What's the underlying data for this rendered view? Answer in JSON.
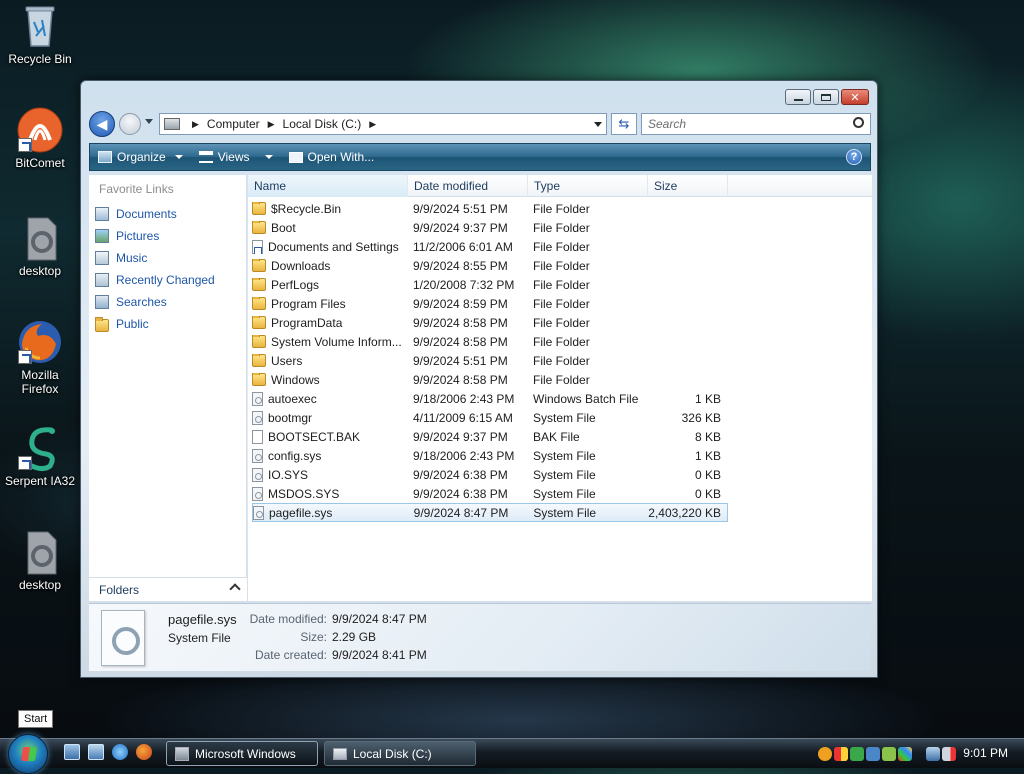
{
  "desktop": {
    "icons": [
      {
        "label": "Recycle Bin"
      },
      {
        "label": "BitComet"
      },
      {
        "label": "desktop"
      },
      {
        "label": "Mozilla Firefox"
      },
      {
        "label": "Serpent IA32"
      },
      {
        "label": "desktop"
      }
    ]
  },
  "window": {
    "breadcrumb": [
      "Computer",
      "Local Disk (C:)"
    ],
    "search_placeholder": "Search",
    "toolbar": {
      "organize": "Organize",
      "views": "Views",
      "open_with": "Open With...",
      "help": "?"
    },
    "nav": {
      "section_title": "Favorite Links",
      "links": [
        "Documents",
        "Pictures",
        "Music",
        "Recently Changed",
        "Searches",
        "Public"
      ],
      "folders_label": "Folders"
    },
    "columns": [
      "Name",
      "Date modified",
      "Type",
      "Size"
    ],
    "files": [
      {
        "name": "$Recycle.Bin",
        "date": "9/9/2024 5:51 PM",
        "type": "File Folder",
        "size": "",
        "icon": "folder"
      },
      {
        "name": "Boot",
        "date": "9/9/2024 9:37 PM",
        "type": "File Folder",
        "size": "",
        "icon": "folder"
      },
      {
        "name": "Documents and Settings",
        "date": "11/2/2006 6:01 AM",
        "type": "File Folder",
        "size": "",
        "icon": "link"
      },
      {
        "name": "Downloads",
        "date": "9/9/2024 8:55 PM",
        "type": "File Folder",
        "size": "",
        "icon": "folder"
      },
      {
        "name": "PerfLogs",
        "date": "1/20/2008 7:32 PM",
        "type": "File Folder",
        "size": "",
        "icon": "folder"
      },
      {
        "name": "Program Files",
        "date": "9/9/2024 8:59 PM",
        "type": "File Folder",
        "size": "",
        "icon": "folder"
      },
      {
        "name": "ProgramData",
        "date": "9/9/2024 8:58 PM",
        "type": "File Folder",
        "size": "",
        "icon": "folder"
      },
      {
        "name": "System Volume Inform...",
        "date": "9/9/2024 8:58 PM",
        "type": "File Folder",
        "size": "",
        "icon": "folder"
      },
      {
        "name": "Users",
        "date": "9/9/2024 5:51 PM",
        "type": "File Folder",
        "size": "",
        "icon": "folder"
      },
      {
        "name": "Windows",
        "date": "9/9/2024 8:58 PM",
        "type": "File Folder",
        "size": "",
        "icon": "folder"
      },
      {
        "name": "autoexec",
        "date": "9/18/2006 2:43 PM",
        "type": "Windows Batch File",
        "size": "1 KB",
        "icon": "sysfile"
      },
      {
        "name": "bootmgr",
        "date": "4/11/2009 6:15 AM",
        "type": "System File",
        "size": "326 KB",
        "icon": "sysfile"
      },
      {
        "name": "BOOTSECT.BAK",
        "date": "9/9/2024 9:37 PM",
        "type": "BAK File",
        "size": "8 KB",
        "icon": "file"
      },
      {
        "name": "config.sys",
        "date": "9/18/2006 2:43 PM",
        "type": "System File",
        "size": "1 KB",
        "icon": "sysfile"
      },
      {
        "name": "IO.SYS",
        "date": "9/9/2024 6:38 PM",
        "type": "System File",
        "size": "0 KB",
        "icon": "sysfile"
      },
      {
        "name": "MSDOS.SYS",
        "date": "9/9/2024 6:38 PM",
        "type": "System File",
        "size": "0 KB",
        "icon": "sysfile"
      },
      {
        "name": "pagefile.sys",
        "date": "9/9/2024 8:47 PM",
        "type": "System File",
        "size": "2,403,220 KB",
        "icon": "sysfile",
        "selected": true
      }
    ],
    "details": {
      "name": "pagefile.sys",
      "type": "System File",
      "date_modified_label": "Date modified:",
      "date_modified": "9/9/2024 8:47 PM",
      "size_label": "Size:",
      "size": "2.29 GB",
      "date_created_label": "Date created:",
      "date_created": "9/9/2024 8:41 PM"
    }
  },
  "taskbar": {
    "start_tooltip": "Start",
    "buttons": [
      "Microsoft Windows",
      "Local Disk (C:)"
    ],
    "clock": "9:01 PM"
  },
  "colors": {
    "accent": "#1e56a8",
    "toolbar": "#2f6a8f"
  }
}
